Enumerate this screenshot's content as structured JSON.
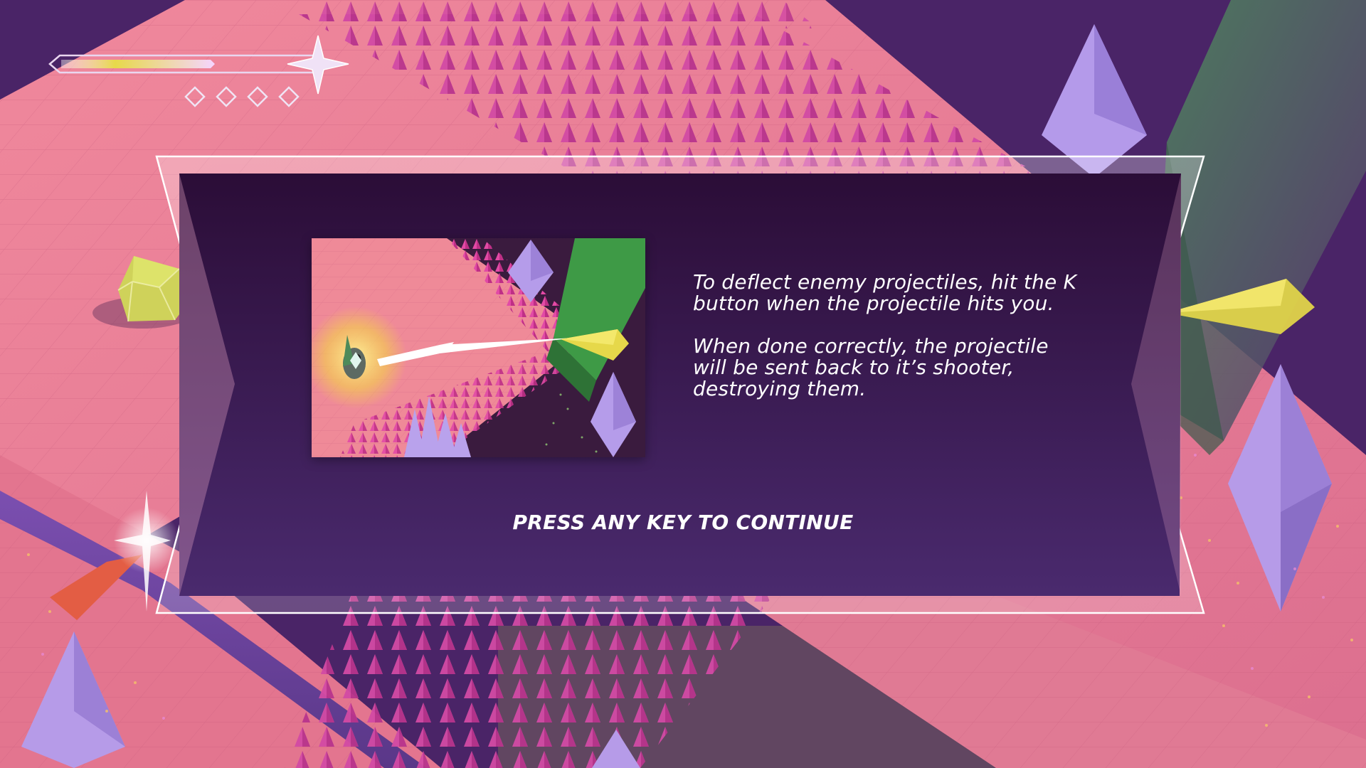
{
  "hud": {
    "health_fill_fraction": 0.6,
    "lives": [
      {
        "icon": "diamond-outline-icon"
      },
      {
        "icon": "diamond-outline-icon"
      },
      {
        "icon": "diamond-outline-icon"
      },
      {
        "icon": "diamond-outline-icon"
      }
    ],
    "star_icon": "four-point-star-icon"
  },
  "dialog": {
    "image_icon": "tutorial-deflect-illustration",
    "paragraphs": [
      "To deflect enemy projectiles, hit the K button when the projectile hits you.",
      "When done correctly, the projectile will be sent back to it’s shooter, destroying them."
    ],
    "continue_label": "PRESS ANY KEY TO CONTINUE"
  },
  "colors": {
    "background": "#4a2467",
    "floor": "#e07a94",
    "spikes": "#d94fa8",
    "crystal": "#a98be0",
    "panel_top": "#2b0d37",
    "panel_bottom": "#4a2a6e",
    "accent_yellow": "#e3d34a",
    "pillar_green": "#3f7a52"
  }
}
